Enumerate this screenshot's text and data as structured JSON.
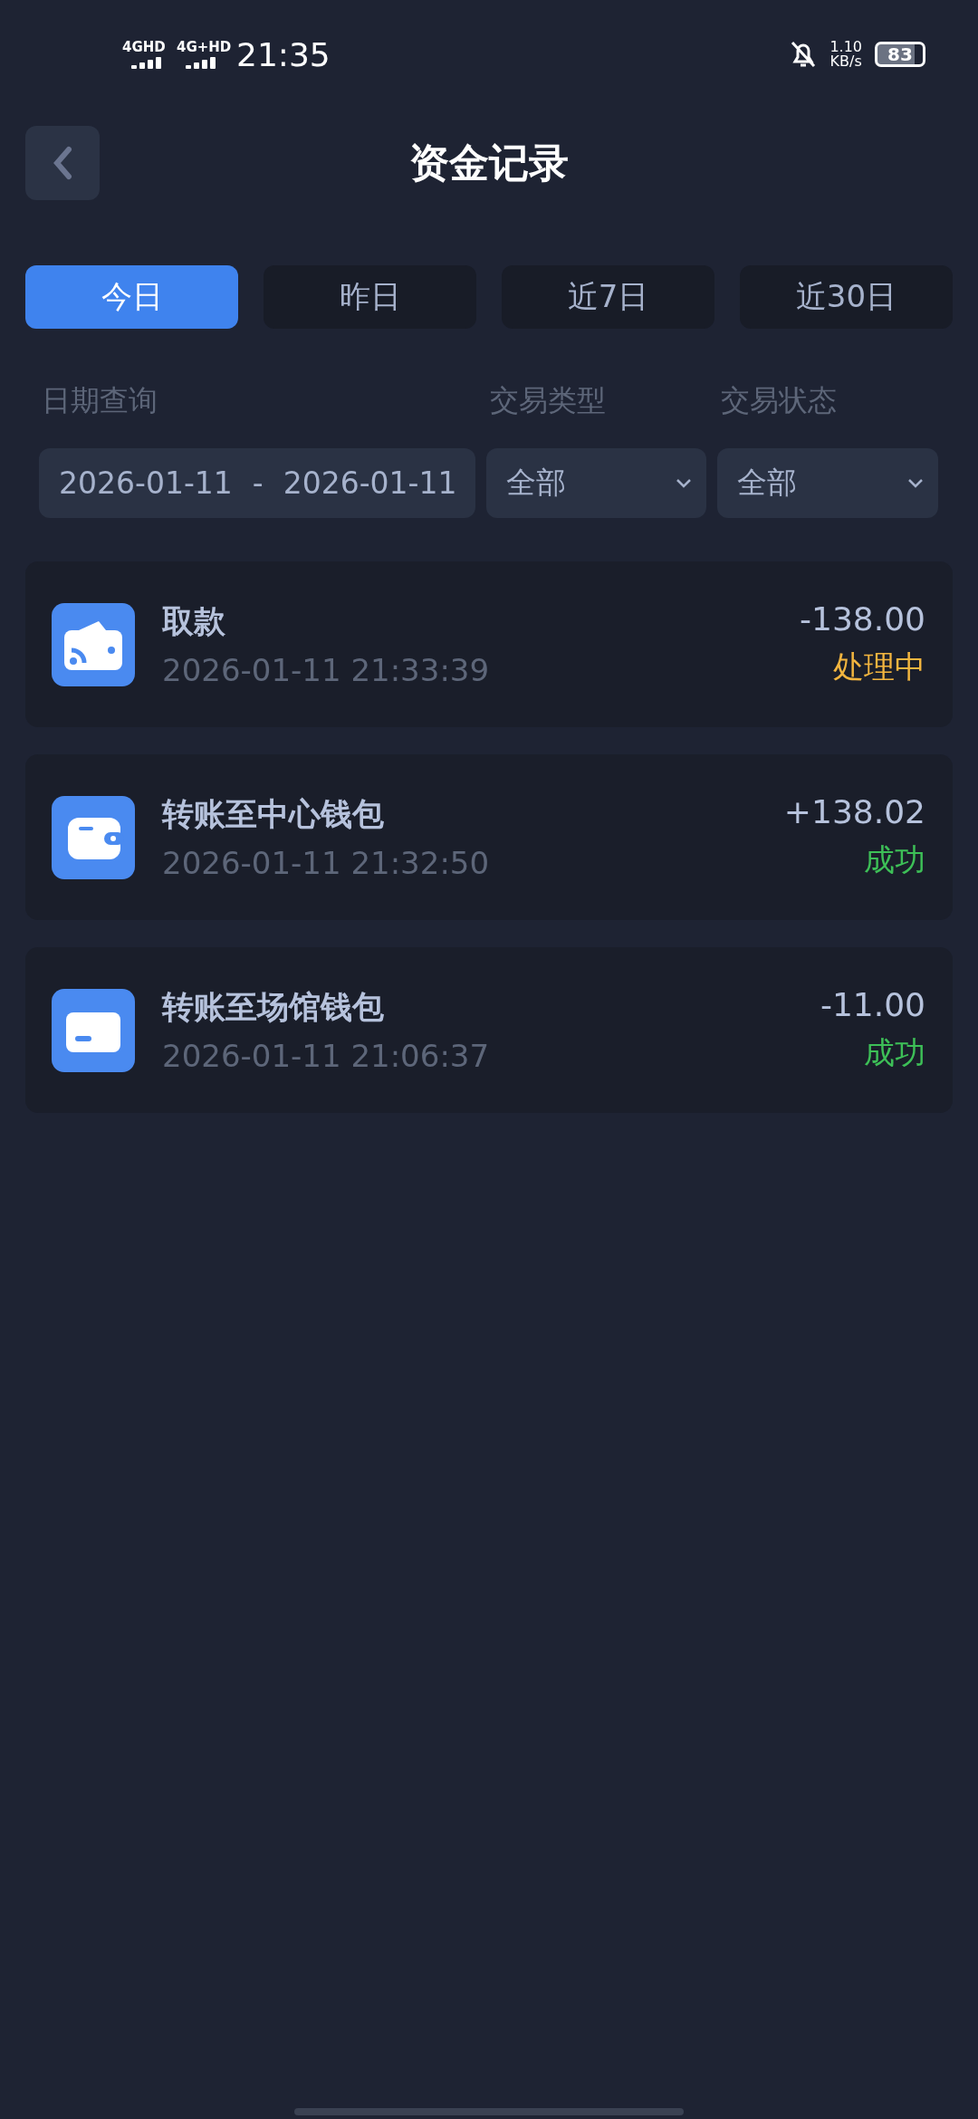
{
  "status_bar": {
    "networks": [
      "4GHD",
      "4G+HD"
    ],
    "time": "21:35",
    "speed_value": "1.10",
    "speed_unit": "KB/s",
    "battery": "83"
  },
  "header": {
    "title": "资金记录"
  },
  "tabs": [
    {
      "label": "今日",
      "selected": true
    },
    {
      "label": "昨日",
      "selected": false
    },
    {
      "label": "近7日",
      "selected": false
    },
    {
      "label": "近30日",
      "selected": false
    }
  ],
  "filters": {
    "date_label": "日期查询",
    "type_label": "交易类型",
    "status_label": "交易状态",
    "date_from": "2026-01-11",
    "date_separator": "-",
    "date_to": "2026-01-11",
    "type_value": "全部",
    "status_value": "全部"
  },
  "records": [
    {
      "kind": "withdraw",
      "title": "取款",
      "time": "2026-01-11 21:33:39",
      "amount": "-138.00",
      "status": "处理中",
      "color": "#f2b53f"
    },
    {
      "kind": "wallet",
      "title": "转账至中心钱包",
      "time": "2026-01-11 21:32:50",
      "amount": "+138.02",
      "status": "成功",
      "color": "#3dbf57"
    },
    {
      "kind": "card",
      "title": "转账至场馆钱包",
      "time": "2026-01-11 21:06:37",
      "amount": "-11.00",
      "status": "成功",
      "color": "#3dbf57"
    }
  ]
}
